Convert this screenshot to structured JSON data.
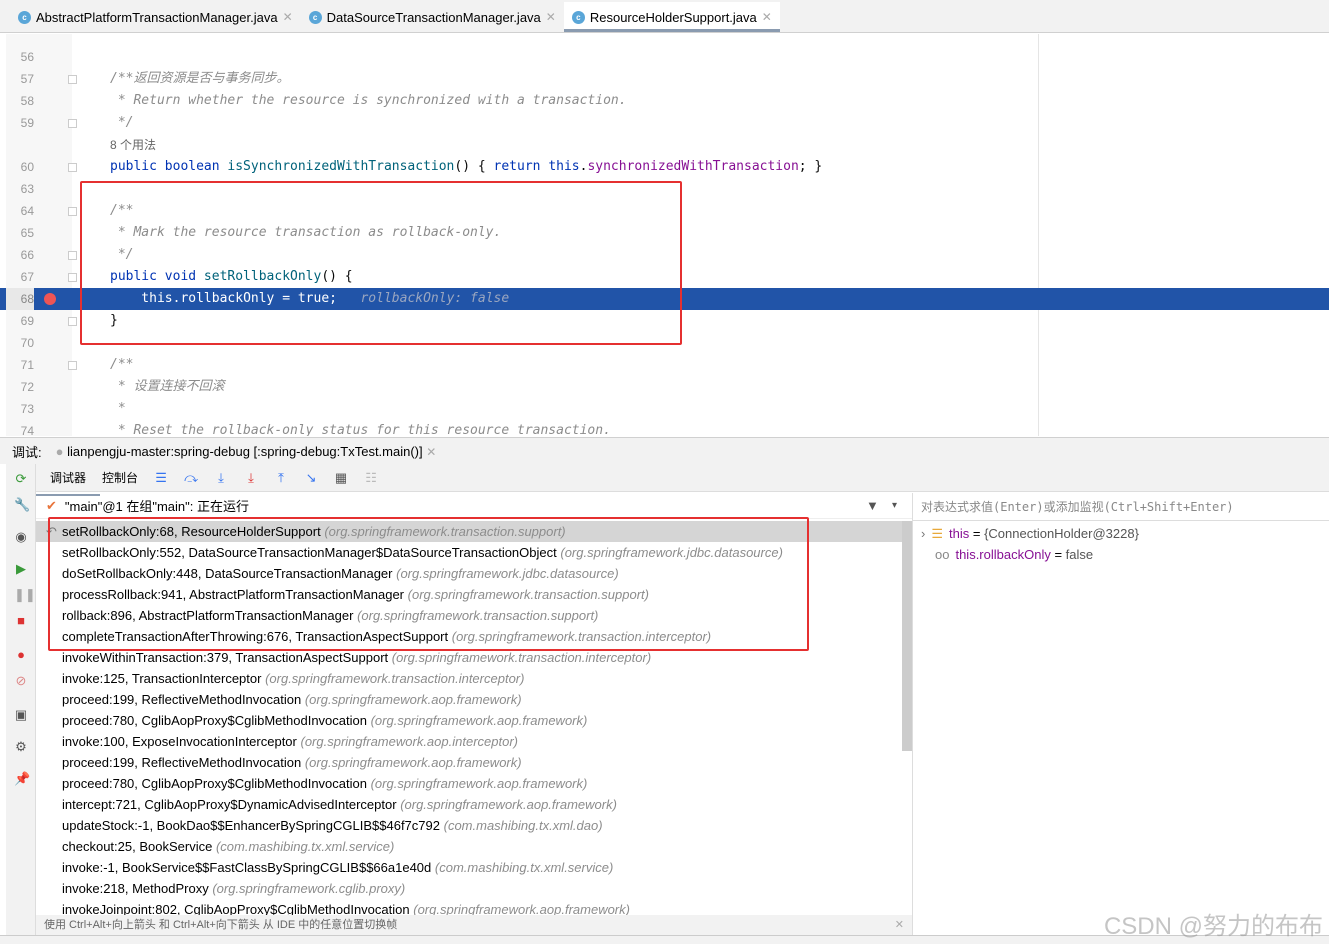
{
  "tabs": [
    {
      "label": "AbstractPlatformTransactionManager.java",
      "active": false
    },
    {
      "label": "DataSourceTransactionManager.java",
      "active": false
    },
    {
      "label": "ResourceHolderSupport.java",
      "active": true
    }
  ],
  "code_lines": [
    {
      "num": "56",
      "segs": []
    },
    {
      "num": "57",
      "segs": [
        [
          "cm",
          "/**返回资源是否与事务同步。"
        ]
      ],
      "fold": true
    },
    {
      "num": "58",
      "segs": [
        [
          "cm",
          " * Return whether the resource is synchronized with a transaction."
        ]
      ]
    },
    {
      "num": "59",
      "segs": [
        [
          "cm",
          " */"
        ]
      ],
      "fold": true
    },
    {
      "num": "",
      "segs": [
        [
          "usage",
          "8 个用法"
        ]
      ]
    },
    {
      "num": "60",
      "segs": [
        [
          "kw",
          "public boolean "
        ],
        [
          "fn",
          "isSynchronizedWithTransaction"
        ],
        [
          "pl",
          "() { "
        ],
        [
          "kw",
          "return this"
        ],
        [
          "pl",
          "."
        ],
        [
          "fld",
          "synchronizedWithTransaction"
        ],
        [
          "pl",
          "; }"
        ]
      ],
      "fold": true
    },
    {
      "num": "63",
      "segs": []
    },
    {
      "num": "64",
      "segs": [
        [
          "cm",
          "/**"
        ]
      ],
      "fold": true
    },
    {
      "num": "65",
      "segs": [
        [
          "cm",
          " * Mark the resource transaction as rollback-only."
        ]
      ]
    },
    {
      "num": "66",
      "segs": [
        [
          "cm",
          " */"
        ]
      ],
      "fold": true
    },
    {
      "num": "67",
      "segs": [
        [
          "kw",
          "public void "
        ],
        [
          "fn",
          "setRollbackOnly"
        ],
        [
          "pl",
          "() {"
        ]
      ],
      "fold": true
    },
    {
      "num": "68",
      "segs": [
        [
          "kw",
          "    this"
        ],
        [
          "pl",
          "."
        ],
        [
          "fld",
          "rollbackOnly"
        ],
        [
          "pl",
          " = "
        ],
        [
          "kw",
          "true"
        ],
        [
          "pl",
          ";   "
        ],
        [
          "hint",
          "rollbackOnly: false"
        ]
      ],
      "highlight": true,
      "breakpoint": true
    },
    {
      "num": "69",
      "segs": [
        [
          "pl",
          "}"
        ]
      ],
      "fold": true
    },
    {
      "num": "70",
      "segs": []
    },
    {
      "num": "71",
      "segs": [
        [
          "cm",
          "/**"
        ]
      ],
      "fold": true
    },
    {
      "num": "72",
      "segs": [
        [
          "cm",
          " * 设置连接不回滚"
        ]
      ]
    },
    {
      "num": "73",
      "segs": [
        [
          "cm",
          " *"
        ]
      ]
    },
    {
      "num": "74",
      "segs": [
        [
          "cm",
          " * Reset the rollback-only status for this resource transaction."
        ]
      ]
    }
  ],
  "debug": {
    "label": "调试:",
    "session": "lianpengju-master:spring-debug [:spring-debug:TxTest.main()]",
    "tab_debugger": "调试器",
    "tab_console": "控制台",
    "thread": "\"main\"@1 在组\"main\": 正在运行",
    "hint": "使用 Ctrl+Alt+向上箭头 和 Ctrl+Alt+向下箭头 从 IDE 中的任意位置切换帧"
  },
  "frames": [
    {
      "m": "setRollbackOnly:68, ResourceHolderSupport",
      "p": "(org.springframework.transaction.support)"
    },
    {
      "m": "setRollbackOnly:552, DataSourceTransactionManager$DataSourceTransactionObject",
      "p": "(org.springframework.jdbc.datasource)"
    },
    {
      "m": "doSetRollbackOnly:448, DataSourceTransactionManager",
      "p": "(org.springframework.jdbc.datasource)"
    },
    {
      "m": "processRollback:941, AbstractPlatformTransactionManager",
      "p": "(org.springframework.transaction.support)"
    },
    {
      "m": "rollback:896, AbstractPlatformTransactionManager",
      "p": "(org.springframework.transaction.support)"
    },
    {
      "m": "completeTransactionAfterThrowing:676, TransactionAspectSupport",
      "p": "(org.springframework.transaction.interceptor)"
    },
    {
      "m": "invokeWithinTransaction:379, TransactionAspectSupport",
      "p": "(org.springframework.transaction.interceptor)"
    },
    {
      "m": "invoke:125, TransactionInterceptor",
      "p": "(org.springframework.transaction.interceptor)"
    },
    {
      "m": "proceed:199, ReflectiveMethodInvocation",
      "p": "(org.springframework.aop.framework)"
    },
    {
      "m": "proceed:780, CglibAopProxy$CglibMethodInvocation",
      "p": "(org.springframework.aop.framework)"
    },
    {
      "m": "invoke:100, ExposeInvocationInterceptor",
      "p": "(org.springframework.aop.interceptor)"
    },
    {
      "m": "proceed:199, ReflectiveMethodInvocation",
      "p": "(org.springframework.aop.framework)"
    },
    {
      "m": "proceed:780, CglibAopProxy$CglibMethodInvocation",
      "p": "(org.springframework.aop.framework)"
    },
    {
      "m": "intercept:721, CglibAopProxy$DynamicAdvisedInterceptor",
      "p": "(org.springframework.aop.framework)"
    },
    {
      "m": "updateStock:-1, BookDao$$EnhancerBySpringCGLIB$$46f7c792",
      "p": "(com.mashibing.tx.xml.dao)"
    },
    {
      "m": "checkout:25, BookService",
      "p": "(com.mashibing.tx.xml.service)"
    },
    {
      "m": "invoke:-1, BookService$$FastClassBySpringCGLIB$$66a1e40d",
      "p": "(com.mashibing.tx.xml.service)"
    },
    {
      "m": "invoke:218, MethodProxy",
      "p": "(org.springframework.cglib.proxy)"
    },
    {
      "m": "invokeJoinpoint:802, CglibAopProxy$CglibMethodInvocation",
      "p": "(org.springframework.aop.framework)"
    }
  ],
  "vars": {
    "placeholder": "对表达式求值(Enter)或添加监视(Ctrl+Shift+Enter)",
    "items": [
      {
        "name": "this",
        "eq": " = ",
        "value": "{ConnectionHolder@3228}",
        "icon": "field-icon"
      },
      {
        "name": "this.rollbackOnly",
        "eq": " = ",
        "value": "false",
        "icon": "watch-icon"
      }
    ]
  },
  "watermark": "CSDN @努力的布布",
  "colors": {
    "highlight": "#2154a8",
    "annotation": "#e53030",
    "keyword": "#0033b3"
  }
}
